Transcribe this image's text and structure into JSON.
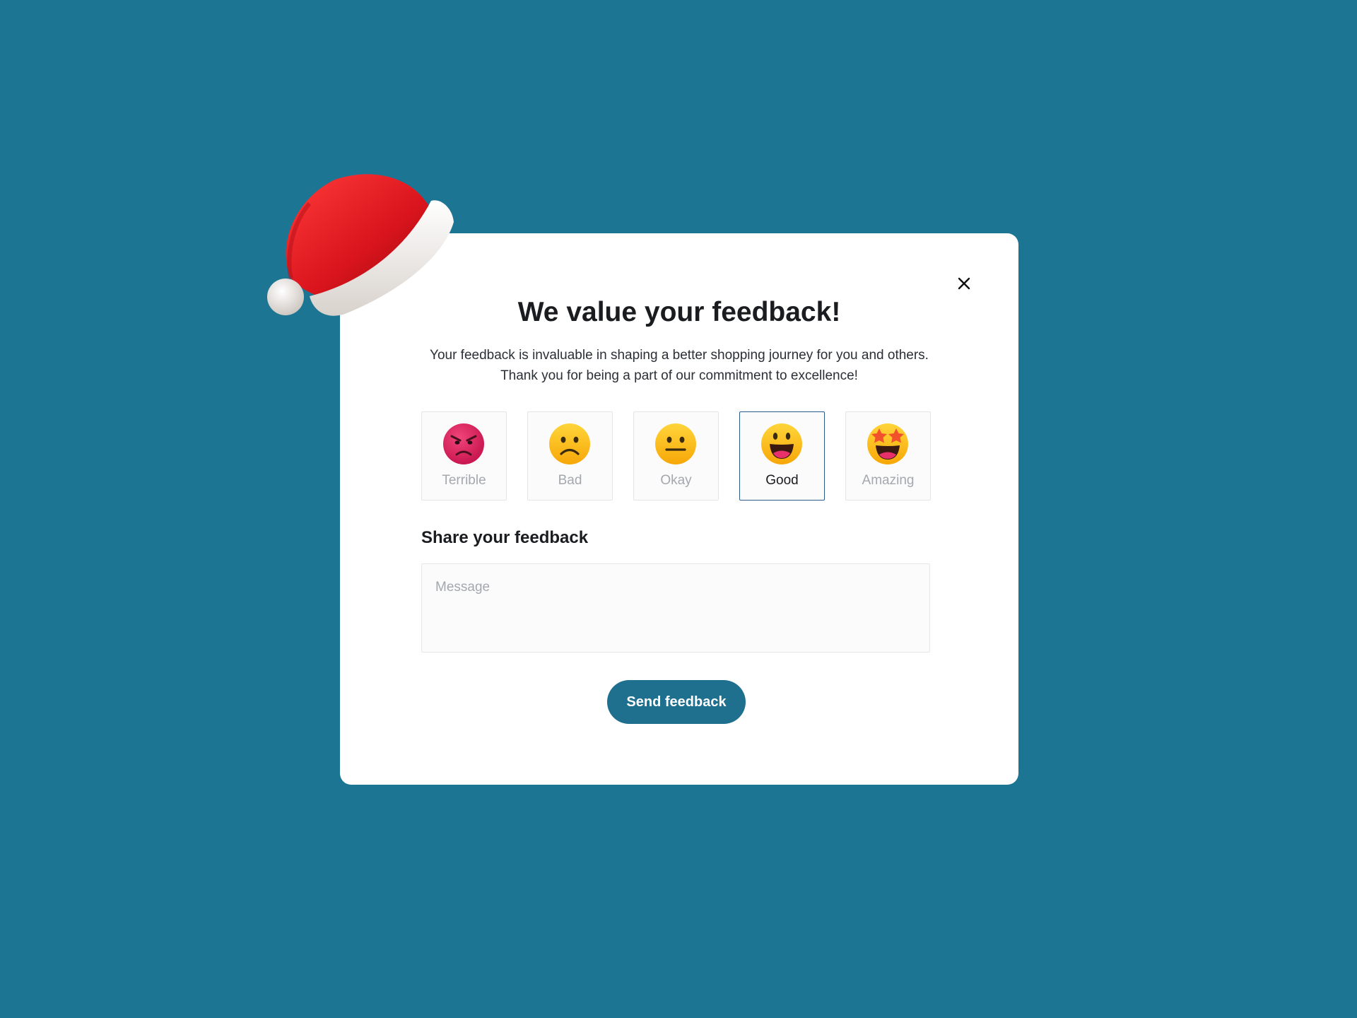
{
  "modal": {
    "title": "We value your feedback!",
    "description": "Your feedback is invaluable in shaping a better shopping journey for you and others. Thank you for being a part of our commitment to excellence!",
    "close_icon": "close-icon"
  },
  "ratings": [
    {
      "label": "Terrible",
      "icon": "angry-face-icon",
      "selected": false
    },
    {
      "label": "Bad",
      "icon": "frowning-face-icon",
      "selected": false
    },
    {
      "label": "Okay",
      "icon": "neutral-face-icon",
      "selected": false
    },
    {
      "label": "Good",
      "icon": "grinning-face-icon",
      "selected": true
    },
    {
      "label": "Amazing",
      "icon": "star-struck-face-icon",
      "selected": false
    }
  ],
  "feedback": {
    "heading": "Share your feedback",
    "placeholder": "Message",
    "value": ""
  },
  "send_button": {
    "label": "Send feedback"
  },
  "colors": {
    "background": "#1d7594",
    "button": "#1f6f8f",
    "selected_border": "#2a5d8c"
  }
}
